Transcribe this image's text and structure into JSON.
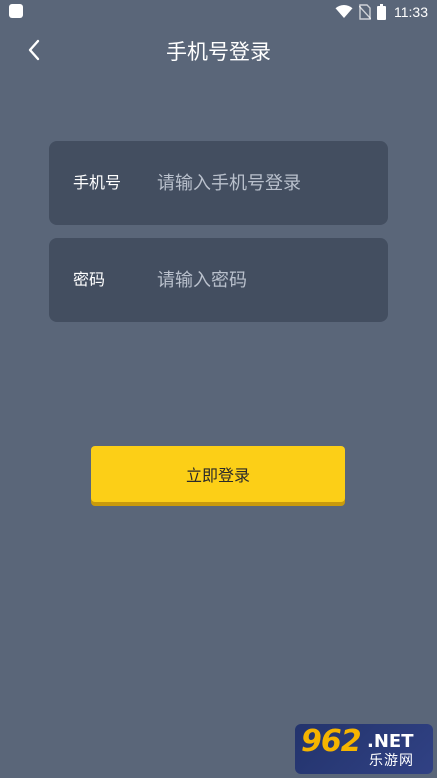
{
  "status_bar": {
    "time": "11:33",
    "icons": [
      "app-indicator-icon",
      "wifi-icon",
      "no-sim-icon",
      "battery-icon"
    ]
  },
  "header": {
    "back_icon": "chevron-left-icon",
    "title": "手机号登录"
  },
  "form": {
    "phone": {
      "label": "手机号",
      "placeholder": "请输入手机号登录",
      "value": ""
    },
    "password": {
      "label": "密码",
      "placeholder": "请输入密码",
      "value": ""
    },
    "submit_label": "立即登录"
  },
  "watermark": {
    "number": "962",
    "domain": ".NET",
    "subtitle": "乐游网"
  },
  "colors": {
    "background": "#5a6679",
    "field_background": "#434e60",
    "button": "#fccf17",
    "button_text": "#2a2a2a",
    "placeholder": "#b9c0cc"
  }
}
